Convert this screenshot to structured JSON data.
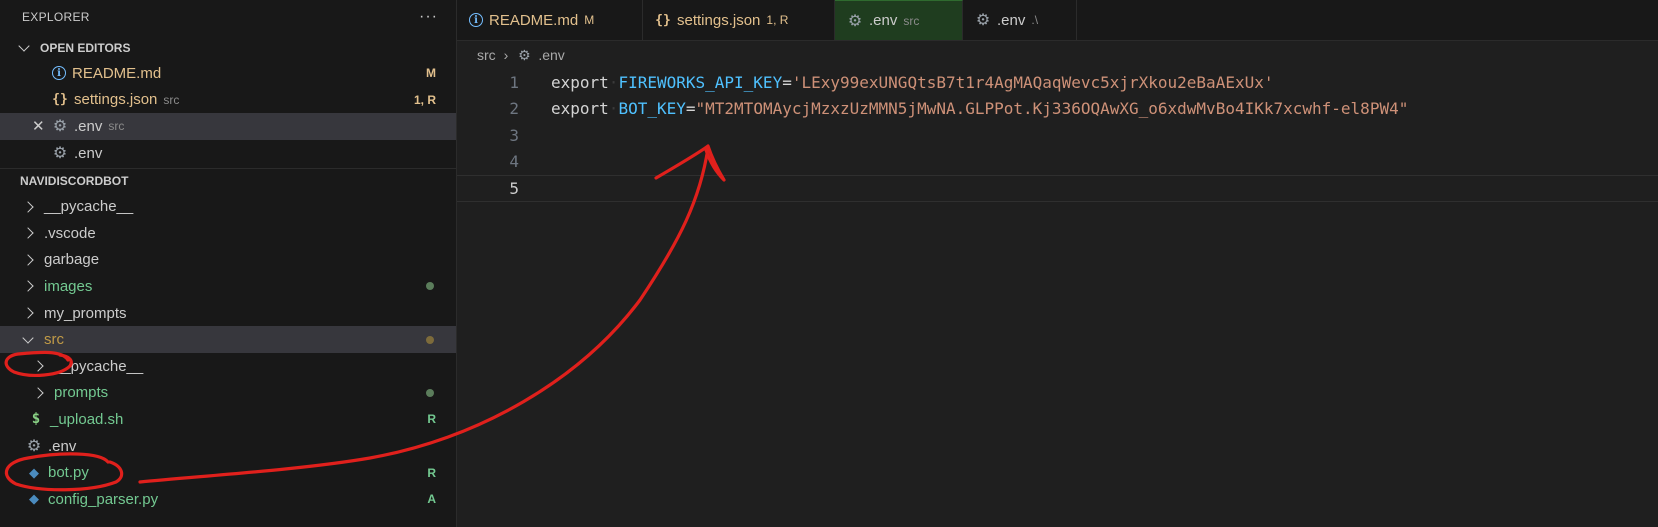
{
  "explorer": {
    "title": "EXPLORER",
    "more": "···",
    "open_editors": {
      "heading": "OPEN EDITORS",
      "items": [
        {
          "name": "README.md",
          "badge": "M"
        },
        {
          "name": "settings.json",
          "desc": "src",
          "badge": "1, R"
        },
        {
          "close": "✕",
          "name": ".env",
          "desc": "src"
        },
        {
          "name": ".env"
        }
      ]
    },
    "project": {
      "heading": "NAVIDISCORDBOT",
      "items": [
        {
          "name": "__pycache__"
        },
        {
          "name": ".vscode"
        },
        {
          "name": "garbage"
        },
        {
          "name": "images"
        },
        {
          "name": "my_prompts"
        },
        {
          "name": "src"
        },
        {
          "name": "__pycache__"
        },
        {
          "name": "prompts"
        },
        {
          "name": "_upload.sh",
          "badge": "R"
        },
        {
          "name": ".env"
        },
        {
          "name": "bot.py",
          "badge": "R"
        },
        {
          "name": "config_parser.py",
          "badge": "A"
        }
      ]
    }
  },
  "tabs": [
    {
      "name": "README.md",
      "desc": "M"
    },
    {
      "name": "settings.json",
      "desc": "1, R"
    },
    {
      "name": ".env",
      "desc": "src"
    },
    {
      "name": ".env",
      "desc": ".\\"
    }
  ],
  "breadcrumb": {
    "folder": "src",
    "sep": "›",
    "file": ".env"
  },
  "code": {
    "lines": [
      {
        "num": "1",
        "kw": "export",
        "var": "FIREWORKS_API_KEY",
        "eq": "=",
        "val": "'LExy99exUNGQtsB7t1r4AgMAQaqWevc5xjrXkou2eBaAExUx'"
      },
      {
        "num": "2",
        "kw": "export",
        "var": "BOT_KEY",
        "eq": "=",
        "val": "\"MT2MTOMAycjMzxzUzMMN5jMwNA.GLPPot.Kj336OQAwXG_o6xdwMvBo4IKk7xcwhf-el8PW4\""
      },
      {
        "num": "3"
      },
      {
        "num": "4"
      },
      {
        "num": "5"
      }
    ]
  },
  "colors": {
    "modified": "#e2c08d",
    "renamed": "#73c991",
    "annotation": "#e0201c"
  },
  "icons": {
    "readme": "info-icon",
    "json": "json-braces-icon",
    "env": "gear-icon",
    "shell": "dollar-icon",
    "python": "python-icon"
  }
}
